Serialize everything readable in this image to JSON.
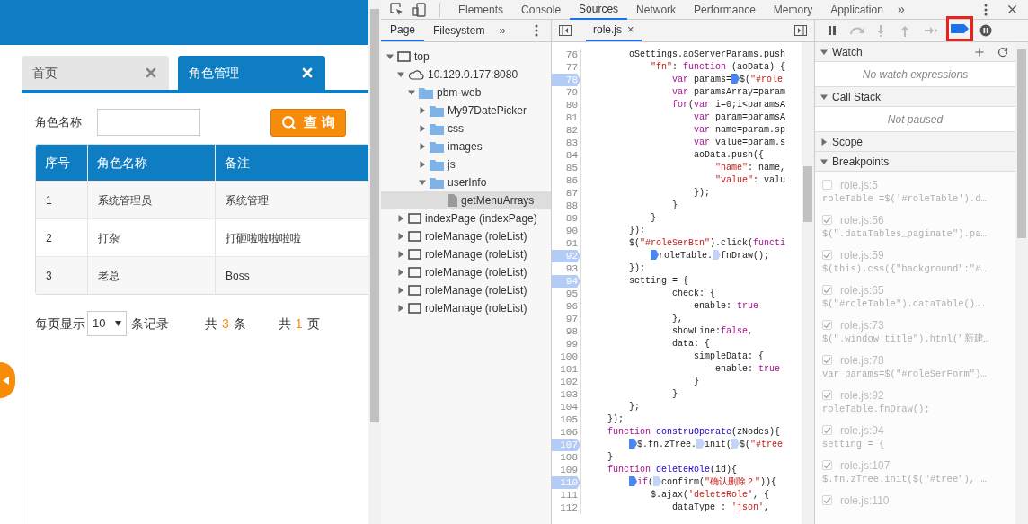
{
  "page": {
    "tabs": [
      {
        "label": "首页",
        "selected": false
      },
      {
        "label": "角色管理",
        "selected": true
      }
    ],
    "search": {
      "label": "角色名称",
      "button": "查 询"
    },
    "table": {
      "columns": [
        "序号",
        "角色名称",
        "备注"
      ],
      "rows": [
        [
          "1",
          "系统管理员",
          "系统管理"
        ],
        [
          "2",
          "打杂",
          "打砸啦啦啦啦啦"
        ],
        [
          "3",
          "老总",
          "Boss"
        ]
      ]
    },
    "pagination": {
      "prefix": "每页显示",
      "page_size": "10",
      "suffix": "条记录",
      "totals": [
        {
          "label": "共",
          "count": "3",
          "unit": "条"
        },
        {
          "label": "共",
          "count": "1",
          "unit": "页"
        }
      ]
    }
  },
  "devtools": {
    "tabs": [
      {
        "label": "Elements",
        "selected": false
      },
      {
        "label": "Console",
        "selected": false
      },
      {
        "label": "Sources",
        "selected": true
      },
      {
        "label": "Network",
        "selected": false
      },
      {
        "label": "Performance",
        "selected": false
      },
      {
        "label": "Memory",
        "selected": false
      },
      {
        "label": "Application",
        "selected": false
      }
    ],
    "more": "»",
    "navigator": {
      "tabs": [
        {
          "label": "Page",
          "selected": true
        },
        {
          "label": "Filesystem",
          "selected": false
        }
      ],
      "more": "»",
      "tree": [
        {
          "label": "top",
          "kind": "frame",
          "expanded": true,
          "selected": false,
          "children": [
            {
              "label": "10.129.0.177:8080",
              "kind": "origin",
              "expanded": true,
              "selected": false,
              "children": [
                {
                  "label": "pbm-web",
                  "kind": "folder",
                  "expanded": true,
                  "selected": false,
                  "children": [
                    {
                      "label": "My97DatePicker",
                      "kind": "folder",
                      "expanded": false,
                      "selected": false
                    },
                    {
                      "label": "css",
                      "kind": "folder",
                      "expanded": false,
                      "selected": false
                    },
                    {
                      "label": "images",
                      "kind": "folder",
                      "expanded": false,
                      "selected": false
                    },
                    {
                      "label": "js",
                      "kind": "folder",
                      "expanded": false,
                      "selected": false
                    },
                    {
                      "label": "userInfo",
                      "kind": "folder",
                      "expanded": true,
                      "selected": false,
                      "children": [
                        {
                          "label": "getMenuArrays",
                          "kind": "file",
                          "selected": true
                        }
                      ]
                    }
                  ]
                }
              ]
            },
            {
              "label": "indexPage (indexPage)",
              "kind": "frame",
              "expanded": false,
              "selected": false
            },
            {
              "label": "roleManage (roleList)",
              "kind": "frame",
              "expanded": false,
              "selected": false
            },
            {
              "label": "roleManage (roleList)",
              "kind": "frame",
              "expanded": false,
              "selected": false
            },
            {
              "label": "roleManage (roleList)",
              "kind": "frame",
              "expanded": false,
              "selected": false
            },
            {
              "label": "roleManage (roleList)",
              "kind": "frame",
              "expanded": false,
              "selected": false
            },
            {
              "label": "roleManage (roleList)",
              "kind": "frame",
              "expanded": false,
              "selected": false
            }
          ]
        }
      ]
    },
    "editor": {
      "file": "role.js",
      "close": "×",
      "lines": [
        {
          "number": "76",
          "breakpoint": false,
          "segs": [
            {
              "kind": "plain",
              "text": "        oSettings.aoServerParams.push"
            }
          ]
        },
        {
          "number": "77",
          "breakpoint": false,
          "segs": [
            {
              "kind": "string",
              "text": "            \"fn\""
            },
            {
              "kind": "plain",
              "text": ": "
            },
            {
              "kind": "keyword",
              "text": "function"
            },
            {
              "kind": "plain",
              "text": " (aoData) {"
            }
          ]
        },
        {
          "number": "78",
          "breakpoint": true,
          "segs": [
            {
              "kind": "keyword",
              "text": "                var"
            },
            {
              "kind": "plain",
              "text": " params="
            },
            {
              "kind": "plain",
              "text": "$(",
              "marker_on": true
            },
            {
              "kind": "string",
              "text": "\"#role"
            }
          ]
        },
        {
          "number": "79",
          "breakpoint": false,
          "segs": [
            {
              "kind": "keyword",
              "text": "                var"
            },
            {
              "kind": "plain",
              "text": " paramsArray=param"
            }
          ]
        },
        {
          "number": "80",
          "breakpoint": false,
          "segs": [
            {
              "kind": "keyword",
              "text": "                for"
            },
            {
              "kind": "plain",
              "text": "("
            },
            {
              "kind": "keyword",
              "text": "var"
            },
            {
              "kind": "plain",
              "text": " i=0;i<paramsA"
            }
          ]
        },
        {
          "number": "81",
          "breakpoint": false,
          "segs": [
            {
              "kind": "keyword",
              "text": "                    var"
            },
            {
              "kind": "plain",
              "text": " param=paramsA"
            }
          ]
        },
        {
          "number": "82",
          "breakpoint": false,
          "segs": [
            {
              "kind": "keyword",
              "text": "                    var"
            },
            {
              "kind": "plain",
              "text": " name=param.sp"
            }
          ]
        },
        {
          "number": "83",
          "breakpoint": false,
          "segs": [
            {
              "kind": "keyword",
              "text": "                    var"
            },
            {
              "kind": "plain",
              "text": " value=param.s"
            }
          ]
        },
        {
          "number": "84",
          "breakpoint": false,
          "segs": [
            {
              "kind": "plain",
              "text": "                    aoData.push({"
            }
          ]
        },
        {
          "number": "85",
          "breakpoint": false,
          "segs": [
            {
              "kind": "string",
              "text": "                        \"name\""
            },
            {
              "kind": "plain",
              "text": ": name,"
            }
          ]
        },
        {
          "number": "86",
          "breakpoint": false,
          "segs": [
            {
              "kind": "string",
              "text": "                        \"value\""
            },
            {
              "kind": "plain",
              "text": ": valu"
            }
          ]
        },
        {
          "number": "87",
          "breakpoint": false,
          "segs": [
            {
              "kind": "plain",
              "text": "                    });"
            }
          ]
        },
        {
          "number": "88",
          "breakpoint": false,
          "segs": [
            {
              "kind": "plain",
              "text": "                }"
            }
          ]
        },
        {
          "number": "89",
          "breakpoint": false,
          "segs": [
            {
              "kind": "plain",
              "text": "            }"
            }
          ]
        },
        {
          "number": "90",
          "breakpoint": false,
          "segs": [
            {
              "kind": "plain",
              "text": "        });"
            }
          ]
        },
        {
          "number": "91",
          "breakpoint": false,
          "segs": [
            {
              "kind": "plain",
              "text": "        $("
            },
            {
              "kind": "string",
              "text": "\"#roleSerBtn\""
            },
            {
              "kind": "plain",
              "text": ").click("
            },
            {
              "kind": "keyword",
              "text": "functi"
            }
          ]
        },
        {
          "number": "92",
          "breakpoint": true,
          "segs": [
            {
              "kind": "plain",
              "text": "            roleTable.",
              "marker_on": true
            },
            {
              "kind": "plain",
              "text": "fnDraw();",
              "marker_on": false
            }
          ]
        },
        {
          "number": "93",
          "breakpoint": false,
          "segs": [
            {
              "kind": "plain",
              "text": "        });"
            }
          ]
        },
        {
          "number": "94",
          "breakpoint": true,
          "segs": [
            {
              "kind": "plain",
              "text": "        setting = {"
            }
          ]
        },
        {
          "number": "95",
          "breakpoint": false,
          "segs": [
            {
              "kind": "plain",
              "text": "                check: {"
            }
          ]
        },
        {
          "number": "96",
          "breakpoint": false,
          "segs": [
            {
              "kind": "plain",
              "text": "                    enable: "
            },
            {
              "kind": "keyword",
              "text": "true"
            }
          ]
        },
        {
          "number": "97",
          "breakpoint": false,
          "segs": [
            {
              "kind": "plain",
              "text": "                },"
            }
          ]
        },
        {
          "number": "98",
          "breakpoint": false,
          "segs": [
            {
              "kind": "plain",
              "text": "                showLine:"
            },
            {
              "kind": "keyword",
              "text": "false"
            },
            {
              "kind": "plain",
              "text": ","
            }
          ]
        },
        {
          "number": "99",
          "breakpoint": false,
          "segs": [
            {
              "kind": "plain",
              "text": "                data: {"
            }
          ]
        },
        {
          "number": "100",
          "breakpoint": false,
          "segs": [
            {
              "kind": "plain",
              "text": "                    simpleData: {"
            }
          ]
        },
        {
          "number": "101",
          "breakpoint": false,
          "segs": [
            {
              "kind": "plain",
              "text": "                        enable: "
            },
            {
              "kind": "keyword",
              "text": "true"
            }
          ]
        },
        {
          "number": "102",
          "breakpoint": false,
          "segs": [
            {
              "kind": "plain",
              "text": "                    }"
            }
          ]
        },
        {
          "number": "103",
          "breakpoint": false,
          "segs": [
            {
              "kind": "plain",
              "text": "                }"
            }
          ]
        },
        {
          "number": "104",
          "breakpoint": false,
          "segs": [
            {
              "kind": "plain",
              "text": "        };"
            }
          ]
        },
        {
          "number": "105",
          "breakpoint": false,
          "segs": [
            {
              "kind": "plain",
              "text": "    });"
            }
          ]
        },
        {
          "number": "106",
          "breakpoint": false,
          "segs": [
            {
              "kind": "keyword",
              "text": "    function"
            },
            {
              "kind": "def",
              "text": " construOperate"
            },
            {
              "kind": "plain",
              "text": "(zNodes){"
            }
          ]
        },
        {
          "number": "107",
          "breakpoint": true,
          "segs": [
            {
              "kind": "plain",
              "text": "        $.fn.zTree.",
              "marker_on": true
            },
            {
              "kind": "plain",
              "text": "init(",
              "marker_on": false
            },
            {
              "kind": "plain",
              "text": "$(",
              "marker_on": false
            },
            {
              "kind": "string",
              "text": "\"#tree"
            }
          ]
        },
        {
          "number": "108",
          "breakpoint": false,
          "segs": [
            {
              "kind": "plain",
              "text": "    }"
            }
          ]
        },
        {
          "number": "109",
          "breakpoint": false,
          "segs": [
            {
              "kind": "keyword",
              "text": "    function"
            },
            {
              "kind": "def",
              "text": " deleteRole"
            },
            {
              "kind": "plain",
              "text": "(id){"
            }
          ]
        },
        {
          "number": "110",
          "breakpoint": true,
          "segs": [
            {
              "kind": "keyword",
              "text": "        if",
              "marker_on": true
            },
            {
              "kind": "plain",
              "text": "("
            },
            {
              "kind": "plain",
              "text": "confirm(",
              "marker_on": false
            },
            {
              "kind": "string",
              "text": "\"确认删除？\""
            },
            {
              "kind": "plain",
              "text": ")){"
            }
          ]
        },
        {
          "number": "111",
          "breakpoint": false,
          "segs": [
            {
              "kind": "plain",
              "text": "            $.ajax("
            },
            {
              "kind": "string",
              "text": "'deleteRole'"
            },
            {
              "kind": "plain",
              "text": ", {"
            }
          ]
        },
        {
          "number": "112",
          "breakpoint": false,
          "segs": [
            {
              "kind": "plain",
              "text": "                dataType : "
            },
            {
              "kind": "string",
              "text": "'json'"
            },
            {
              "kind": "plain",
              "text": ","
            }
          ]
        }
      ]
    },
    "debugger": {
      "breakpoints_deactivated": true,
      "sections": [
        {
          "title": "Watch",
          "kind": "watch",
          "expanded": true,
          "message": "No watch expressions"
        },
        {
          "title": "Call Stack",
          "kind": "plain",
          "expanded": true,
          "message": "Not paused"
        },
        {
          "title": "Scope",
          "kind": "plain",
          "expanded": false
        },
        {
          "title": "Breakpoints",
          "kind": "breakpoints",
          "expanded": true
        }
      ],
      "breakpoints": [
        {
          "location": "role.js:5",
          "code": "roleTable =$('#roleTable').d…",
          "checked": false
        },
        {
          "location": "role.js:56",
          "code": "$(\".dataTables_paginate\").pa…",
          "checked": true
        },
        {
          "location": "role.js:59",
          "code": "$(this).css({\"background\":\"#…",
          "checked": true
        },
        {
          "location": "role.js:65",
          "code": "$(\"#roleTable\").dataTable()….",
          "checked": true
        },
        {
          "location": "role.js:73",
          "code": "$(\".window_title\").html(\"新建…",
          "checked": true
        },
        {
          "location": "role.js:78",
          "code": "var params=$(\"#roleSerForm\")…",
          "checked": true
        },
        {
          "location": "role.js:92",
          "code": "roleTable.fnDraw();",
          "checked": true
        },
        {
          "location": "role.js:94",
          "code": "setting = {",
          "checked": true
        },
        {
          "location": "role.js:107",
          "code": "$.fn.zTree.init($(\"#tree\"), …",
          "checked": true
        },
        {
          "location": "role.js:110",
          "checked": true
        }
      ]
    }
  }
}
